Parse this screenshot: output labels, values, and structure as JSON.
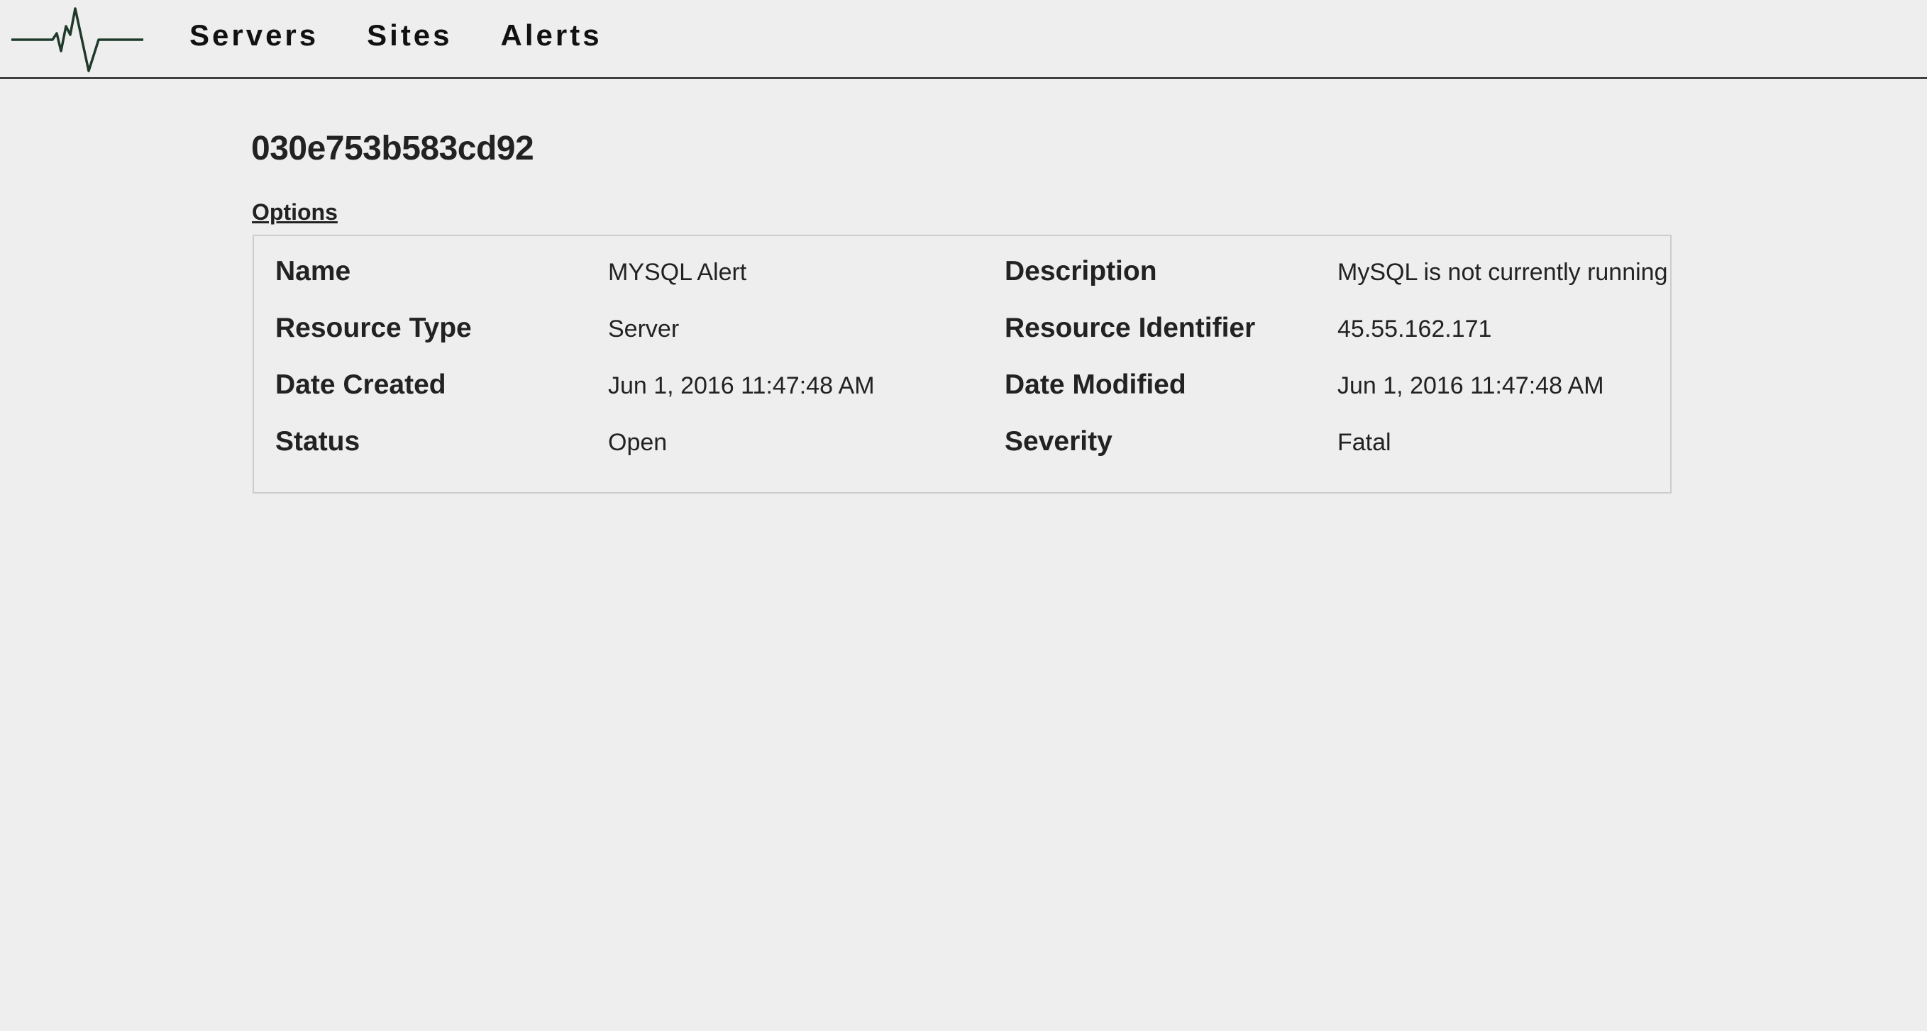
{
  "nav": {
    "logo": "heartbeat-logo",
    "items": [
      {
        "label": "Servers"
      },
      {
        "label": "Sites"
      },
      {
        "label": "Alerts"
      }
    ]
  },
  "alert": {
    "id": "030e753b583cd92",
    "options_label": "Options",
    "fields": {
      "name": {
        "label": "Name",
        "value": "MYSQL Alert"
      },
      "description": {
        "label": "Description",
        "value": "MySQL is not currently running"
      },
      "resource_type": {
        "label": "Resource Type",
        "value": "Server"
      },
      "resource_identifier": {
        "label": "Resource Identifier",
        "value": "45.55.162.171"
      },
      "date_created": {
        "label": "Date Created",
        "value": "Jun 1, 2016 11:47:48 AM"
      },
      "date_modified": {
        "label": "Date Modified",
        "value": "Jun 1, 2016 11:47:48 AM"
      },
      "status": {
        "label": "Status",
        "value": "Open"
      },
      "severity": {
        "label": "Severity",
        "value": "Fatal"
      }
    }
  },
  "colors": {
    "background": "#eeeeee",
    "text": "#222222",
    "panel_border": "#cccccc",
    "logo_line": "#1f3a2a"
  }
}
